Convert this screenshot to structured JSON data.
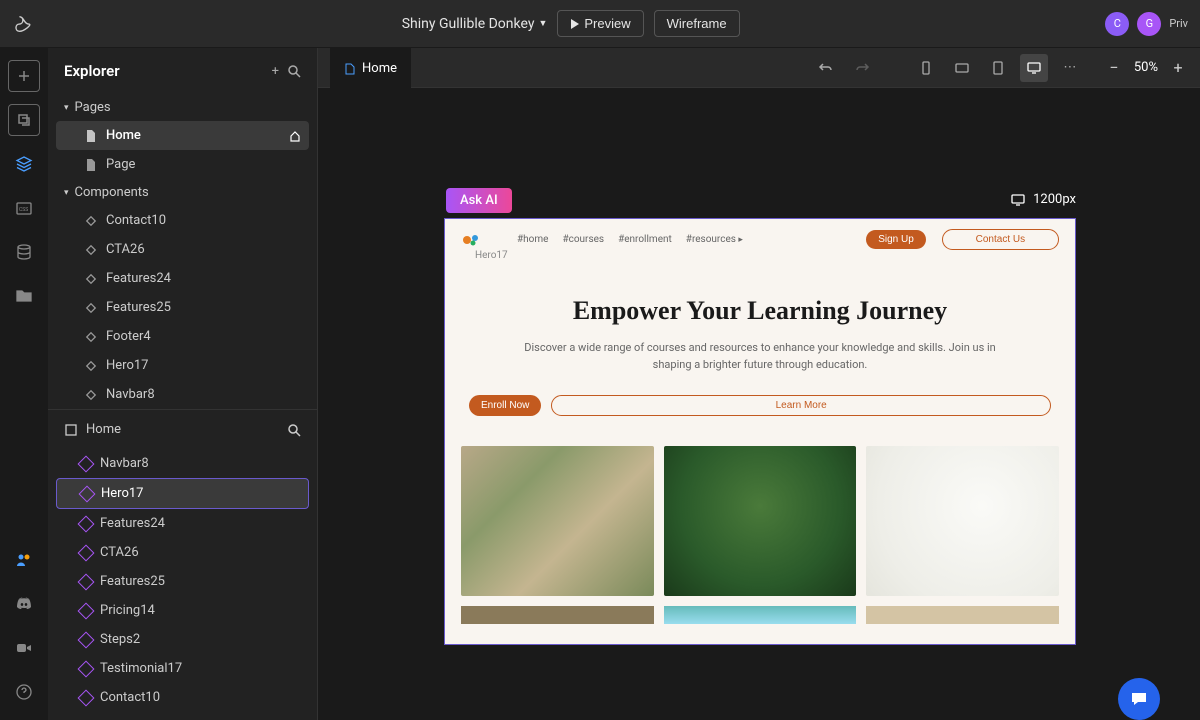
{
  "project_name": "Shiny Gullible Donkey",
  "top_buttons": {
    "preview": "Preview",
    "wireframe": "Wireframe"
  },
  "avatars": [
    "C",
    "G"
  ],
  "privacy_label": "Priv",
  "explorer": {
    "title": "Explorer",
    "pages_label": "Pages",
    "pages": [
      "Home",
      "Page"
    ],
    "active_page": "Home",
    "components_label": "Components",
    "components": [
      "Contact10",
      "CTA26",
      "Features24",
      "Features25",
      "Footer4",
      "Hero17",
      "Navbar8"
    ]
  },
  "outline": {
    "root": "Home",
    "items": [
      "Navbar8",
      "Hero17",
      "Features24",
      "CTA26",
      "Features25",
      "Pricing14",
      "Steps2",
      "Testimonial17",
      "Contact10"
    ],
    "active": "Hero17"
  },
  "canvas_tab": "Home",
  "zoom": "50%",
  "ask_ai": "Ask AI",
  "canvas_width_label": "1200px",
  "preview": {
    "logo_label": "Hero17",
    "nav_links": [
      "#home",
      "#courses",
      "#enrollment",
      "#resources"
    ],
    "signup": "Sign Up",
    "contact": "Contact Us",
    "hero_title": "Empower Your Learning Journey",
    "hero_sub": "Discover a wide range of courses and resources to enhance your knowledge and skills. Join us in shaping a brighter future through education.",
    "enroll": "Enroll Now",
    "learn": "Learn More"
  }
}
